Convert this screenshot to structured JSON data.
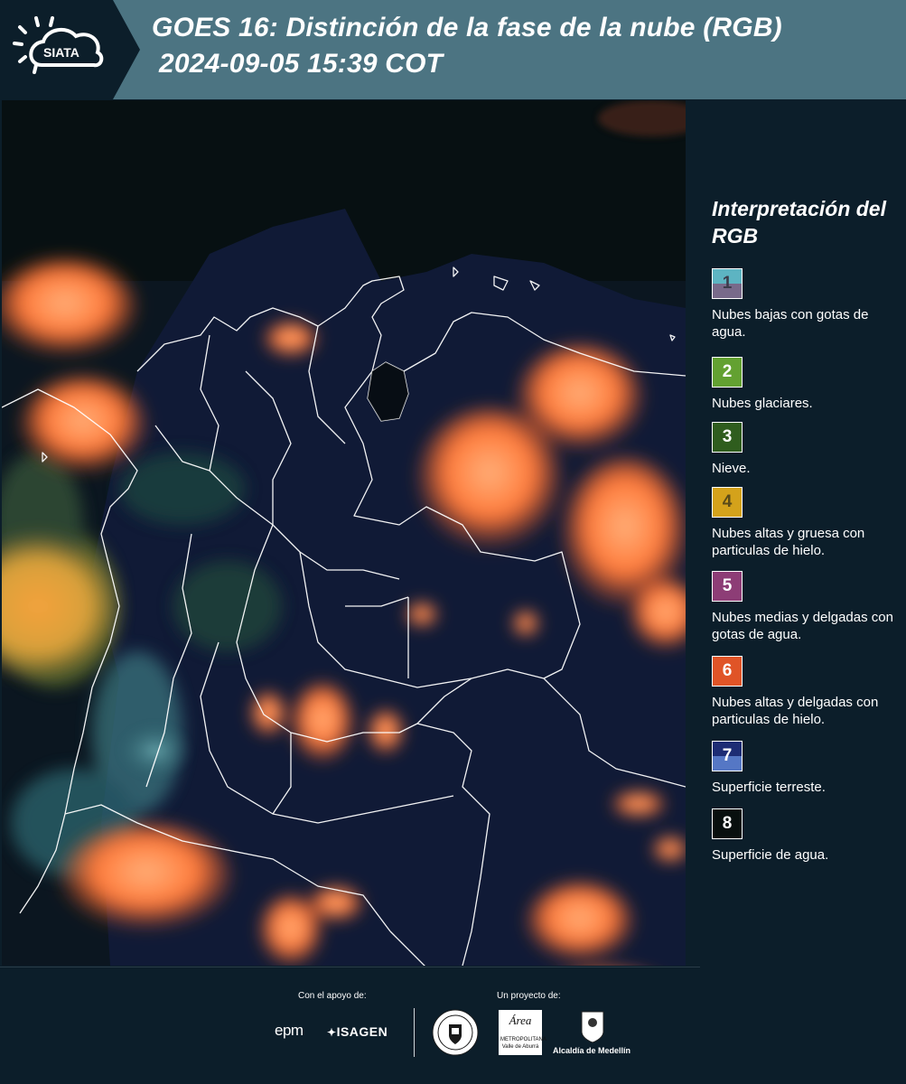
{
  "header": {
    "logo_text": "SIATA",
    "title_line1": "GOES 16: Distinción de la fase de la nube (RGB)",
    "title_line2": "2024-09-05 15:39 COT"
  },
  "legend": {
    "title": "Interpretación del RGB",
    "items": [
      {
        "num": "1",
        "label": "Nubes bajas con gotas de agua.",
        "color_top": "#5db4c2",
        "color_bottom": "#786a8a"
      },
      {
        "num": "2",
        "label": "Nubes glaciares.",
        "color": "#63a131"
      },
      {
        "num": "3",
        "label": "Nieve.",
        "color": "#2f5d1e"
      },
      {
        "num": "4",
        "label": "Nubes altas y gruesa con particulas de hielo.",
        "color": "#d4a21b"
      },
      {
        "num": "5",
        "label": "Nubes medias y delgadas con gotas de agua.",
        "color": "#8d3d76"
      },
      {
        "num": "6",
        "label": "Nubes altas y delgadas con particulas de hielo.",
        "color": "#e05427"
      },
      {
        "num": "7",
        "label": "Superficie terreste.",
        "color_top": "#1d2c74",
        "color_bottom": "#5577c5"
      },
      {
        "num": "8",
        "label": "Superficie de agua.",
        "color": "#080f0e"
      }
    ]
  },
  "footer": {
    "support_label": "Con el apoyo de:",
    "project_label": "Un proyecto de:",
    "epm": "epm",
    "isagen": "ISAGEN",
    "amva_lines": [
      "Área",
      "METROPOLITANA",
      "Valle de Aburrá"
    ],
    "medellin": "Alcaldía de Medellín"
  }
}
